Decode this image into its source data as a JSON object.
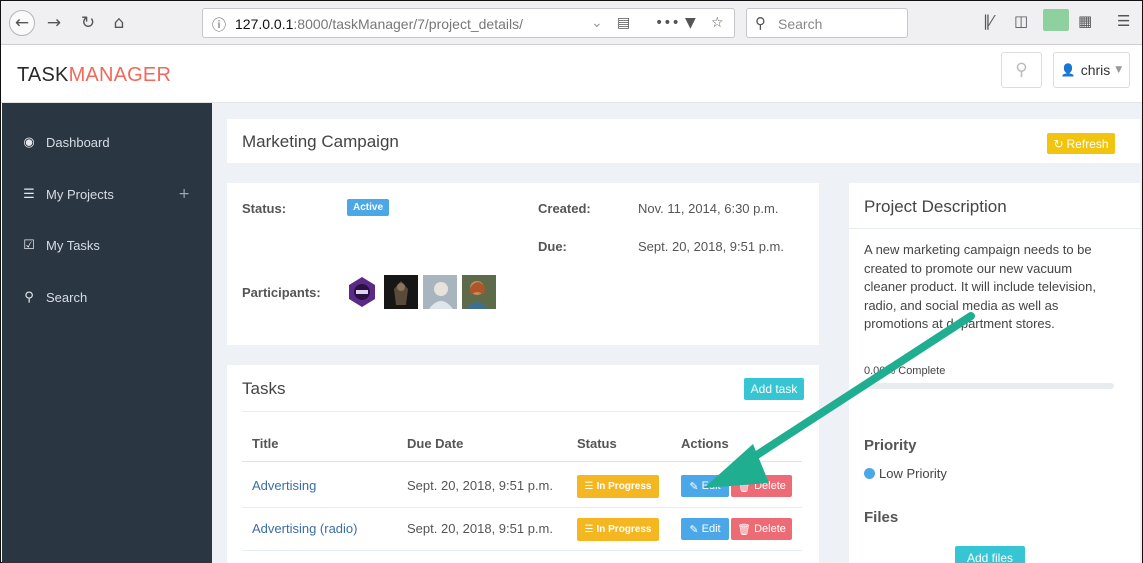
{
  "browser": {
    "url_host": "127.0.0.1",
    "url_rest": ":8000/taskManager/7/project_details/",
    "search_placeholder": "Search"
  },
  "header": {
    "brand_part1": "TASK",
    "brand_part2": "MANAGER",
    "user_name": "chris"
  },
  "sidebar": {
    "items": [
      {
        "label": "Dashboard",
        "icon": "dashboard-icon"
      },
      {
        "label": "My Projects",
        "icon": "list-icon"
      },
      {
        "label": "My Tasks",
        "icon": "checkbox-icon"
      },
      {
        "label": "Search",
        "icon": "search-icon"
      }
    ],
    "add_symbol": "+"
  },
  "project": {
    "title": "Marketing Campaign",
    "refresh_label": "Refresh",
    "status_label": "Status:",
    "status_value": "Active",
    "created_label": "Created:",
    "created_value": "Nov. 11, 2014, 6:30 p.m.",
    "due_label": "Due:",
    "due_value": "Sept. 20, 2018, 9:51 p.m.",
    "participants_label": "Participants:"
  },
  "tasks": {
    "title": "Tasks",
    "add_label": "Add task",
    "columns": [
      "Title",
      "Due Date",
      "Status",
      "Actions"
    ],
    "rows": [
      {
        "title": "Advertising",
        "due": "Sept. 20, 2018, 9:51 p.m.",
        "status": "In Progress",
        "edit": "Edit",
        "delete": "Delete"
      },
      {
        "title": "Advertising (radio)",
        "due": "Sept. 20, 2018, 9:51 p.m.",
        "status": "In Progress",
        "edit": "Edit",
        "delete": "Delete"
      }
    ]
  },
  "description": {
    "title": "Project Description",
    "text": "A new marketing campaign needs to be created to promote our new vacuum cleaner product. It will include television, radio, and social media as well as promotions at department stores.",
    "progress_label": "0.00% Complete",
    "progress": 0,
    "priority_title": "Priority",
    "priority_value": "Low Priority",
    "files_title": "Files",
    "add_files_label": "Add files"
  },
  "colors": {
    "sidebar_bg": "#2b3643",
    "brand_accent": "#f0695a",
    "annotation_arrow": "#1fae90"
  }
}
